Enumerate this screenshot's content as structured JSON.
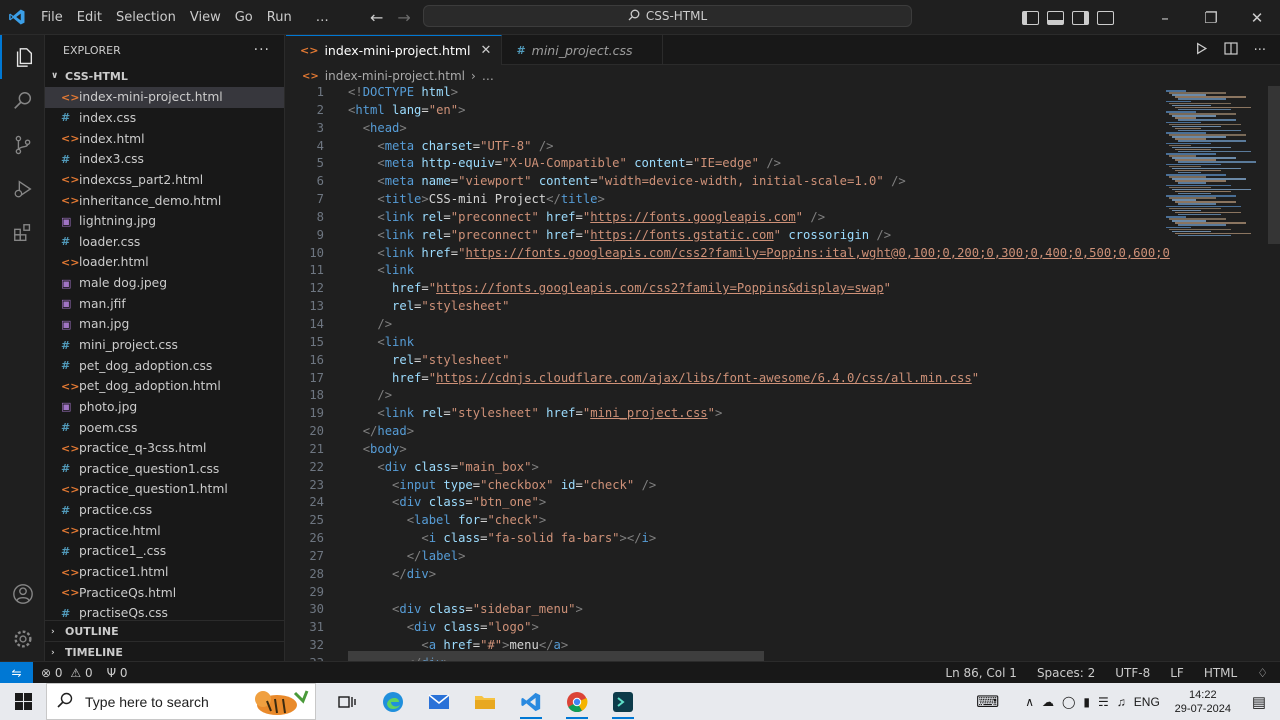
{
  "titlebar": {
    "menus": [
      "File",
      "Edit",
      "Selection",
      "View",
      "Go",
      "Run",
      "…"
    ],
    "command_center": "CSS-HTML"
  },
  "explorer": {
    "title": "EXPLORER",
    "folder": "CSS-HTML",
    "files": [
      {
        "name": "index-mini-project.html",
        "type": "html",
        "selected": true
      },
      {
        "name": "index.css",
        "type": "css"
      },
      {
        "name": "index.html",
        "type": "html"
      },
      {
        "name": "index3.css",
        "type": "css"
      },
      {
        "name": "indexcss_part2.html",
        "type": "html"
      },
      {
        "name": "inheritance_demo.html",
        "type": "html"
      },
      {
        "name": "lightning.jpg",
        "type": "img"
      },
      {
        "name": "loader.css",
        "type": "css"
      },
      {
        "name": "loader.html",
        "type": "html"
      },
      {
        "name": "male dog.jpeg",
        "type": "img"
      },
      {
        "name": "man.jfif",
        "type": "img"
      },
      {
        "name": "man.jpg",
        "type": "img"
      },
      {
        "name": "mini_project.css",
        "type": "css"
      },
      {
        "name": "pet_dog_adoption.css",
        "type": "css"
      },
      {
        "name": "pet_dog_adoption.html",
        "type": "html"
      },
      {
        "name": "photo.jpg",
        "type": "img"
      },
      {
        "name": "poem.css",
        "type": "css"
      },
      {
        "name": "practice_q-3css.html",
        "type": "html"
      },
      {
        "name": "practice_question1.css",
        "type": "css"
      },
      {
        "name": "practice_question1.html",
        "type": "html"
      },
      {
        "name": "practice.css",
        "type": "css"
      },
      {
        "name": "practice.html",
        "type": "html"
      },
      {
        "name": "practice1_.css",
        "type": "css"
      },
      {
        "name": "practice1.html",
        "type": "html"
      },
      {
        "name": "PracticeQs.html",
        "type": "html"
      },
      {
        "name": "practiseQs.css",
        "type": "css"
      }
    ],
    "outline": "OUTLINE",
    "timeline": "TIMELINE"
  },
  "tabs": [
    {
      "label": "index-mini-project.html",
      "type": "html",
      "active": true
    },
    {
      "label": "mini_project.css",
      "type": "css",
      "active": false
    }
  ],
  "breadcrumb": {
    "file": "index-mini-project.html",
    "more": "…"
  },
  "code_lines": [
    [
      [
        "t",
        "<!"
      ],
      [
        "tn",
        "DOCTYPE"
      ],
      [
        "pl",
        " "
      ],
      [
        "an",
        "html"
      ],
      [
        "t",
        ">"
      ]
    ],
    [
      [
        "t",
        "<"
      ],
      [
        "tn",
        "html"
      ],
      [
        "pl",
        " "
      ],
      [
        "an",
        "lang"
      ],
      [
        "pl",
        "="
      ],
      [
        "av",
        "\"en\""
      ],
      [
        "t",
        ">"
      ]
    ],
    [
      [
        "pl",
        "  "
      ],
      [
        "t",
        "<"
      ],
      [
        "tn",
        "head"
      ],
      [
        "t",
        ">"
      ]
    ],
    [
      [
        "pl",
        "    "
      ],
      [
        "t",
        "<"
      ],
      [
        "tn",
        "meta"
      ],
      [
        "pl",
        " "
      ],
      [
        "an",
        "charset"
      ],
      [
        "pl",
        "="
      ],
      [
        "av",
        "\"UTF-8\""
      ],
      [
        "pl",
        " "
      ],
      [
        "t",
        "/>"
      ]
    ],
    [
      [
        "pl",
        "    "
      ],
      [
        "t",
        "<"
      ],
      [
        "tn",
        "meta"
      ],
      [
        "pl",
        " "
      ],
      [
        "an",
        "http-equiv"
      ],
      [
        "pl",
        "="
      ],
      [
        "av",
        "\"X-UA-Compatible\""
      ],
      [
        "pl",
        " "
      ],
      [
        "an",
        "content"
      ],
      [
        "pl",
        "="
      ],
      [
        "av",
        "\"IE=edge\""
      ],
      [
        "pl",
        " "
      ],
      [
        "t",
        "/>"
      ]
    ],
    [
      [
        "pl",
        "    "
      ],
      [
        "t",
        "<"
      ],
      [
        "tn",
        "meta"
      ],
      [
        "pl",
        " "
      ],
      [
        "an",
        "name"
      ],
      [
        "pl",
        "="
      ],
      [
        "av",
        "\"viewport\""
      ],
      [
        "pl",
        " "
      ],
      [
        "an",
        "content"
      ],
      [
        "pl",
        "="
      ],
      [
        "av",
        "\"width=device-width, initial-scale=1.0\""
      ],
      [
        "pl",
        " "
      ],
      [
        "t",
        "/>"
      ]
    ],
    [
      [
        "pl",
        "    "
      ],
      [
        "t",
        "<"
      ],
      [
        "tn",
        "title"
      ],
      [
        "t",
        ">"
      ],
      [
        "pl",
        "CSS-mini Project"
      ],
      [
        "t",
        "</"
      ],
      [
        "tn",
        "title"
      ],
      [
        "t",
        ">"
      ]
    ],
    [
      [
        "pl",
        "    "
      ],
      [
        "t",
        "<"
      ],
      [
        "tn",
        "link"
      ],
      [
        "pl",
        " "
      ],
      [
        "an",
        "rel"
      ],
      [
        "pl",
        "="
      ],
      [
        "av",
        "\"preconnect\""
      ],
      [
        "pl",
        " "
      ],
      [
        "an",
        "href"
      ],
      [
        "pl",
        "="
      ],
      [
        "av",
        "\""
      ],
      [
        "url",
        "https://fonts.googleapis.com"
      ],
      [
        "av",
        "\""
      ],
      [
        "pl",
        " "
      ],
      [
        "t",
        "/>"
      ]
    ],
    [
      [
        "pl",
        "    "
      ],
      [
        "t",
        "<"
      ],
      [
        "tn",
        "link"
      ],
      [
        "pl",
        " "
      ],
      [
        "an",
        "rel"
      ],
      [
        "pl",
        "="
      ],
      [
        "av",
        "\"preconnect\""
      ],
      [
        "pl",
        " "
      ],
      [
        "an",
        "href"
      ],
      [
        "pl",
        "="
      ],
      [
        "av",
        "\""
      ],
      [
        "url",
        "https://fonts.gstatic.com"
      ],
      [
        "av",
        "\""
      ],
      [
        "pl",
        " "
      ],
      [
        "an",
        "crossorigin"
      ],
      [
        "pl",
        " "
      ],
      [
        "t",
        "/>"
      ]
    ],
    [
      [
        "pl",
        "    "
      ],
      [
        "t",
        "<"
      ],
      [
        "tn",
        "link"
      ],
      [
        "pl",
        " "
      ],
      [
        "an",
        "href"
      ],
      [
        "pl",
        "="
      ],
      [
        "av",
        "\""
      ],
      [
        "url",
        "https://fonts.googleapis.com/css2?family=Poppins:ital,wght@0,100;0,200;0,300;0,400;0,500;0,600;0"
      ]
    ],
    [
      [
        "pl",
        "    "
      ],
      [
        "t",
        "<"
      ],
      [
        "tn",
        "link"
      ]
    ],
    [
      [
        "pl",
        "      "
      ],
      [
        "an",
        "href"
      ],
      [
        "pl",
        "="
      ],
      [
        "av",
        "\""
      ],
      [
        "url",
        "https://fonts.googleapis.com/css2?family=Poppins&display=swap"
      ],
      [
        "av",
        "\""
      ]
    ],
    [
      [
        "pl",
        "      "
      ],
      [
        "an",
        "rel"
      ],
      [
        "pl",
        "="
      ],
      [
        "av",
        "\"stylesheet\""
      ]
    ],
    [
      [
        "pl",
        "    "
      ],
      [
        "t",
        "/>"
      ]
    ],
    [
      [
        "pl",
        "    "
      ],
      [
        "t",
        "<"
      ],
      [
        "tn",
        "link"
      ]
    ],
    [
      [
        "pl",
        "      "
      ],
      [
        "an",
        "rel"
      ],
      [
        "pl",
        "="
      ],
      [
        "av",
        "\"stylesheet\""
      ]
    ],
    [
      [
        "pl",
        "      "
      ],
      [
        "an",
        "href"
      ],
      [
        "pl",
        "="
      ],
      [
        "av",
        "\""
      ],
      [
        "url",
        "https://cdnjs.cloudflare.com/ajax/libs/font-awesome/6.4.0/css/all.min.css"
      ],
      [
        "av",
        "\""
      ]
    ],
    [
      [
        "pl",
        "    "
      ],
      [
        "t",
        "/>"
      ]
    ],
    [
      [
        "pl",
        "    "
      ],
      [
        "t",
        "<"
      ],
      [
        "tn",
        "link"
      ],
      [
        "pl",
        " "
      ],
      [
        "an",
        "rel"
      ],
      [
        "pl",
        "="
      ],
      [
        "av",
        "\"stylesheet\""
      ],
      [
        "pl",
        " "
      ],
      [
        "an",
        "href"
      ],
      [
        "pl",
        "="
      ],
      [
        "av",
        "\""
      ],
      [
        "url",
        "mini_project.css"
      ],
      [
        "av",
        "\""
      ],
      [
        "t",
        ">"
      ]
    ],
    [
      [
        "pl",
        "  "
      ],
      [
        "t",
        "</"
      ],
      [
        "tn",
        "head"
      ],
      [
        "t",
        ">"
      ]
    ],
    [
      [
        "pl",
        "  "
      ],
      [
        "t",
        "<"
      ],
      [
        "tn",
        "body"
      ],
      [
        "t",
        ">"
      ]
    ],
    [
      [
        "pl",
        "    "
      ],
      [
        "t",
        "<"
      ],
      [
        "tn",
        "div"
      ],
      [
        "pl",
        " "
      ],
      [
        "an",
        "class"
      ],
      [
        "pl",
        "="
      ],
      [
        "av",
        "\"main_box\""
      ],
      [
        "t",
        ">"
      ]
    ],
    [
      [
        "pl",
        "      "
      ],
      [
        "t",
        "<"
      ],
      [
        "tn",
        "input"
      ],
      [
        "pl",
        " "
      ],
      [
        "an",
        "type"
      ],
      [
        "pl",
        "="
      ],
      [
        "av",
        "\"checkbox\""
      ],
      [
        "pl",
        " "
      ],
      [
        "an",
        "id"
      ],
      [
        "pl",
        "="
      ],
      [
        "av",
        "\"check\""
      ],
      [
        "pl",
        " "
      ],
      [
        "t",
        "/>"
      ]
    ],
    [
      [
        "pl",
        "      "
      ],
      [
        "t",
        "<"
      ],
      [
        "tn",
        "div"
      ],
      [
        "pl",
        " "
      ],
      [
        "an",
        "class"
      ],
      [
        "pl",
        "="
      ],
      [
        "av",
        "\"btn_one\""
      ],
      [
        "t",
        ">"
      ]
    ],
    [
      [
        "pl",
        "        "
      ],
      [
        "t",
        "<"
      ],
      [
        "tn",
        "label"
      ],
      [
        "pl",
        " "
      ],
      [
        "an",
        "for"
      ],
      [
        "pl",
        "="
      ],
      [
        "av",
        "\"check\""
      ],
      [
        "t",
        ">"
      ]
    ],
    [
      [
        "pl",
        "          "
      ],
      [
        "t",
        "<"
      ],
      [
        "tn",
        "i"
      ],
      [
        "pl",
        " "
      ],
      [
        "an",
        "class"
      ],
      [
        "pl",
        "="
      ],
      [
        "av",
        "\"fa-solid fa-bars\""
      ],
      [
        "t",
        "></"
      ],
      [
        "tn",
        "i"
      ],
      [
        "t",
        ">"
      ]
    ],
    [
      [
        "pl",
        "        "
      ],
      [
        "t",
        "</"
      ],
      [
        "tn",
        "label"
      ],
      [
        "t",
        ">"
      ]
    ],
    [
      [
        "pl",
        "      "
      ],
      [
        "t",
        "</"
      ],
      [
        "tn",
        "div"
      ],
      [
        "t",
        ">"
      ]
    ],
    [],
    [
      [
        "pl",
        "      "
      ],
      [
        "t",
        "<"
      ],
      [
        "tn",
        "div"
      ],
      [
        "pl",
        " "
      ],
      [
        "an",
        "class"
      ],
      [
        "pl",
        "="
      ],
      [
        "av",
        "\"sidebar_menu\""
      ],
      [
        "t",
        ">"
      ]
    ],
    [
      [
        "pl",
        "        "
      ],
      [
        "t",
        "<"
      ],
      [
        "tn",
        "div"
      ],
      [
        "pl",
        " "
      ],
      [
        "an",
        "class"
      ],
      [
        "pl",
        "="
      ],
      [
        "av",
        "\"logo\""
      ],
      [
        "t",
        ">"
      ]
    ],
    [
      [
        "pl",
        "          "
      ],
      [
        "t",
        "<"
      ],
      [
        "tn",
        "a"
      ],
      [
        "pl",
        " "
      ],
      [
        "an",
        "href"
      ],
      [
        "pl",
        "="
      ],
      [
        "av",
        "\"#\""
      ],
      [
        "t",
        ">"
      ],
      [
        "pl",
        "menu"
      ],
      [
        "t",
        "</"
      ],
      [
        "tn",
        "a"
      ],
      [
        "t",
        ">"
      ]
    ],
    [
      [
        "pl",
        "        "
      ],
      [
        "t",
        "</"
      ],
      [
        "tn",
        "div"
      ],
      [
        "t",
        ">"
      ]
    ]
  ],
  "statusbar": {
    "errors": "0",
    "warnings": "0",
    "ports": "0",
    "position": "Ln 86, Col 1",
    "spaces": "Spaces: 2",
    "encoding": "UTF-8",
    "eol": "LF",
    "language": "HTML"
  },
  "taskbar": {
    "search_placeholder": "Type here to search",
    "language": "ENG",
    "time": "14:22",
    "date": "29-07-2024"
  },
  "colors": {
    "accent": "#0078d4",
    "html_icon": "#e37933",
    "css_icon": "#519aba",
    "image_icon": "#a074c4"
  }
}
